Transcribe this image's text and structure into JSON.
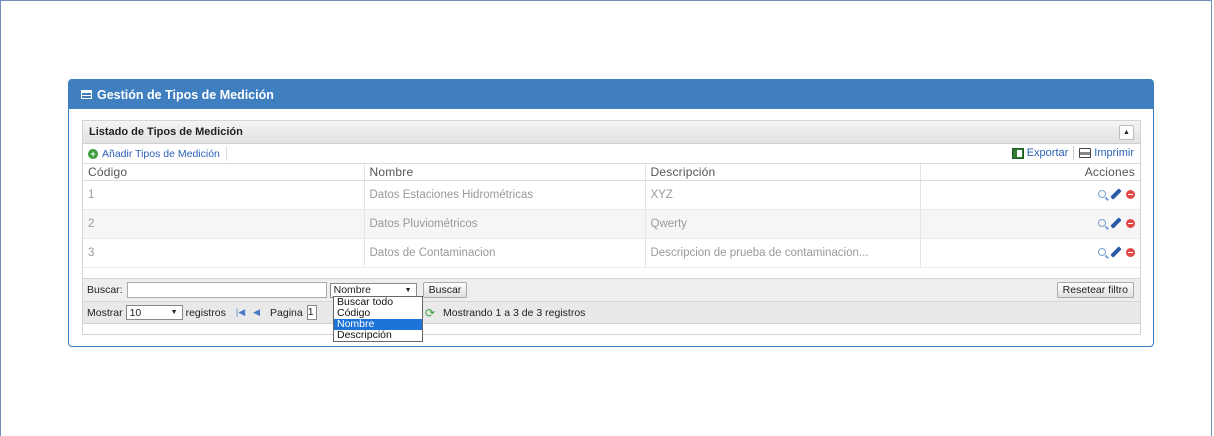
{
  "panel": {
    "title": "Gestión de Tipos de Medición"
  },
  "grid": {
    "title": "Listado de Tipos de Medición",
    "add_label": "Añadir Tipos de Medición",
    "export_label": "Exportar",
    "print_label": "Imprimir",
    "columns": [
      "Código",
      "Nombre",
      "Descripción",
      "Acciones"
    ],
    "rows": [
      {
        "codigo": "1",
        "nombre": "Datos Estaciones Hidrométricas",
        "descripcion": "XYZ"
      },
      {
        "codigo": "2",
        "nombre": "Datos Pluviométricos",
        "descripcion": "Qwerty"
      },
      {
        "codigo": "3",
        "nombre": "Datos de Contaminacion",
        "descripcion": "Descripcion de prueba de contaminacion..."
      }
    ]
  },
  "search": {
    "label": "Buscar:",
    "value": "",
    "field_selected": "Nombre",
    "button_label": "Buscar",
    "reset_label": "Resetear filtro",
    "options": [
      "Buscar todo",
      "Código",
      "Nombre",
      "Descripción"
    ]
  },
  "pager": {
    "show_label": "Mostrar",
    "page_size": "10",
    "records_label": "registros",
    "page_label": "Pagina",
    "page_value": "1",
    "summary": "Mostrando 1 a 3 de 3 registros"
  },
  "icons": {
    "add": "plus-circle-icon",
    "export": "excel-icon",
    "print": "printer-icon",
    "view": "magnifier-icon",
    "edit": "pencil-icon",
    "delete": "minus-circle-icon"
  },
  "colors": {
    "header_blue": "#3f7fc0",
    "selected_option": "#1e73d8"
  }
}
